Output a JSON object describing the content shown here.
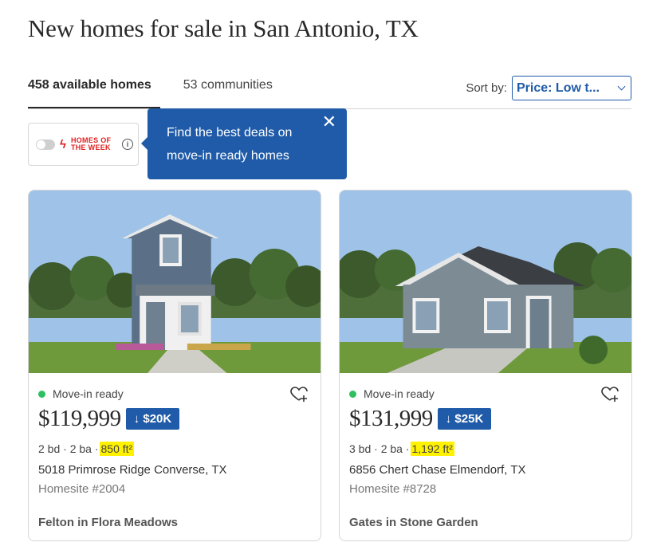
{
  "page": {
    "title": "New homes for sale in San Antonio, TX"
  },
  "tabs": [
    {
      "label": "458 available homes",
      "active": true
    },
    {
      "label": "53 communities",
      "active": false
    }
  ],
  "sort": {
    "label": "Sort by:",
    "value": "Price: Low t..."
  },
  "homes_of_week": {
    "label_line1": "HOMES OF",
    "label_line2": "THE WEEK",
    "toggle_on": false,
    "info_icon": "info-icon"
  },
  "tooltip": {
    "text_line1": "Find the best deals on",
    "text_line2": "move-in ready homes",
    "close_icon": "close-icon"
  },
  "colors": {
    "accent": "#1f5ba8",
    "status_green": "#2ec060",
    "homes_of_week_red": "#e02020",
    "highlight": "#fff200"
  },
  "listings": [
    {
      "status": "Move-in ready",
      "price": "$119,999",
      "discount": "↓ $20K",
      "beds_baths": "2 bd · 2 ba ·",
      "sqft": "850 ft²",
      "address": "5018 Primrose Ridge Converse, TX",
      "homesite": "Homesite #2004",
      "community": "Felton in Flora Meadows"
    },
    {
      "status": "Move-in ready",
      "price": "$131,999",
      "discount": "↓ $25K",
      "beds_baths": "3 bd · 2 ba ·",
      "sqft": "1,192 ft²",
      "address": "6856 Chert Chase Elmendorf, TX",
      "homesite": "Homesite #8728",
      "community": "Gates in Stone Garden"
    }
  ]
}
